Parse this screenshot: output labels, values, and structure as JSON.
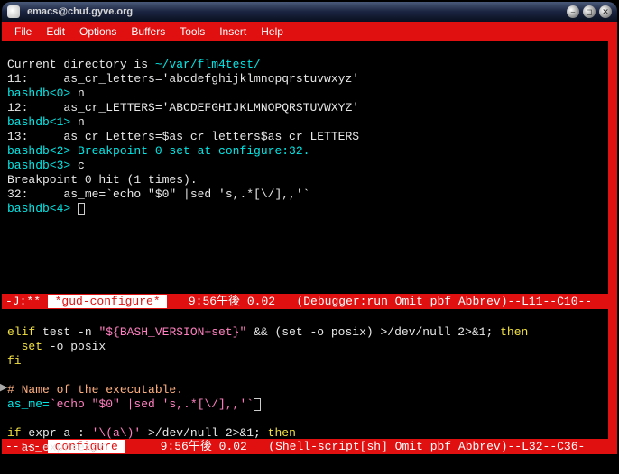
{
  "window": {
    "title": "emacs@chuf.gyve.org",
    "btn_min": "⎯",
    "btn_max": "◻",
    "btn_close": "✕"
  },
  "menu": {
    "file": "File",
    "edit": "Edit",
    "options": "Options",
    "buffers": "Buffers",
    "tools": "Tools",
    "insert": "Insert",
    "help": "Help"
  },
  "pane1": {
    "l1a": "Current directory is ",
    "l1b": "~/var/flm4test/",
    "l2": "11:     as_cr_letters='abcdefghijklmnopqrstuvwxyz'",
    "l3a": "bashdb<0>",
    "l3b": " n",
    "l4": "12:     as_cr_LETTERS='ABCDEFGHIJKLMNOPQRSTUVWXYZ'",
    "l5a": "bashdb<1>",
    "l5b": " n",
    "l6": "13:     as_cr_Letters=$as_cr_letters$as_cr_LETTERS",
    "l7": "bashdb<2> Breakpoint 0 set at configure:32.",
    "l8a": "bashdb<3>",
    "l8b": " c",
    "l9": "Breakpoint 0 hit (1 times).",
    "l10": "32:     as_me=`echo \"$0\" |sed 's,.*[\\/],,'`",
    "l11": "bashdb<4> "
  },
  "modeline1": {
    "left": "-J:** ",
    "buf": " *gud-configure* ",
    "rest": "   9:56午後 0.02   (Debugger:run Omit pbf Abbrev)--L11--C10--"
  },
  "pane2": {
    "l1a": "elif",
    "l1b": " test -n ",
    "l1c": "\"${BASH_VERSION+set}\"",
    "l1d": " && (set -o posix) >/dev/null 2>&1; ",
    "l1e": "then",
    "l2a": "  set",
    "l2b": " -o posix",
    "l3": "fi",
    "l5": "# Name of the executable.",
    "l6a": "as_me=",
    "l6b": "`echo \"$0\" |sed 's,.*[\\/],,'`",
    "l8a": "if",
    "l8b": " expr a : ",
    "l8c": "'\\(a\\)'",
    "l8d": " >/dev/null 2>&1; ",
    "l8e": "then",
    "l9": "  as_expr=expr"
  },
  "modeline2": {
    "left": "--:-- ",
    "buf": " configure ",
    "rest": "     9:56午後 0.02   (Shell-script[sh] Omit pbf Abbrev)--L32--C36-"
  }
}
